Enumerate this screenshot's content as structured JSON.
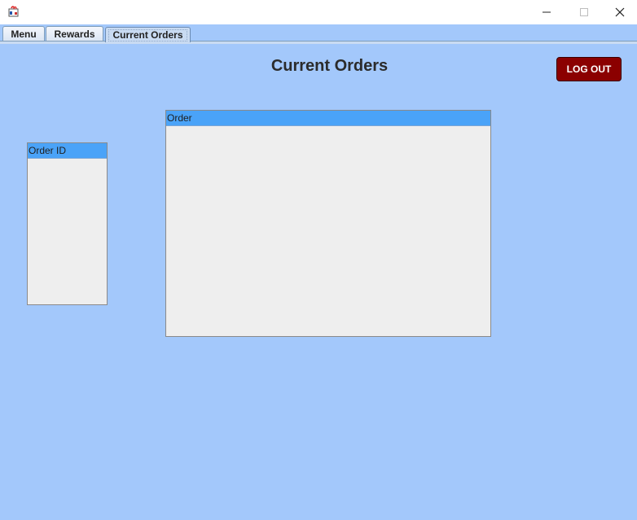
{
  "window": {
    "title": "",
    "controls": {
      "minimize_icon": "minimize-icon",
      "maximize_icon": "maximize-icon",
      "close_icon": "close-icon"
    }
  },
  "tabs": [
    {
      "label": "Menu",
      "selected": false
    },
    {
      "label": "Rewards",
      "selected": false
    },
    {
      "label": "Current Orders",
      "selected": true
    }
  ],
  "page": {
    "title": "Current Orders",
    "logout_label": "LOG OUT"
  },
  "tables": {
    "order_id": {
      "header": "Order ID",
      "rows": []
    },
    "order": {
      "header": "Order",
      "rows": []
    }
  },
  "colors": {
    "background": "#a3c8fb",
    "table_header": "#4aa3f8",
    "table_body": "#eeeeee",
    "logout_button": "#8b0000"
  }
}
